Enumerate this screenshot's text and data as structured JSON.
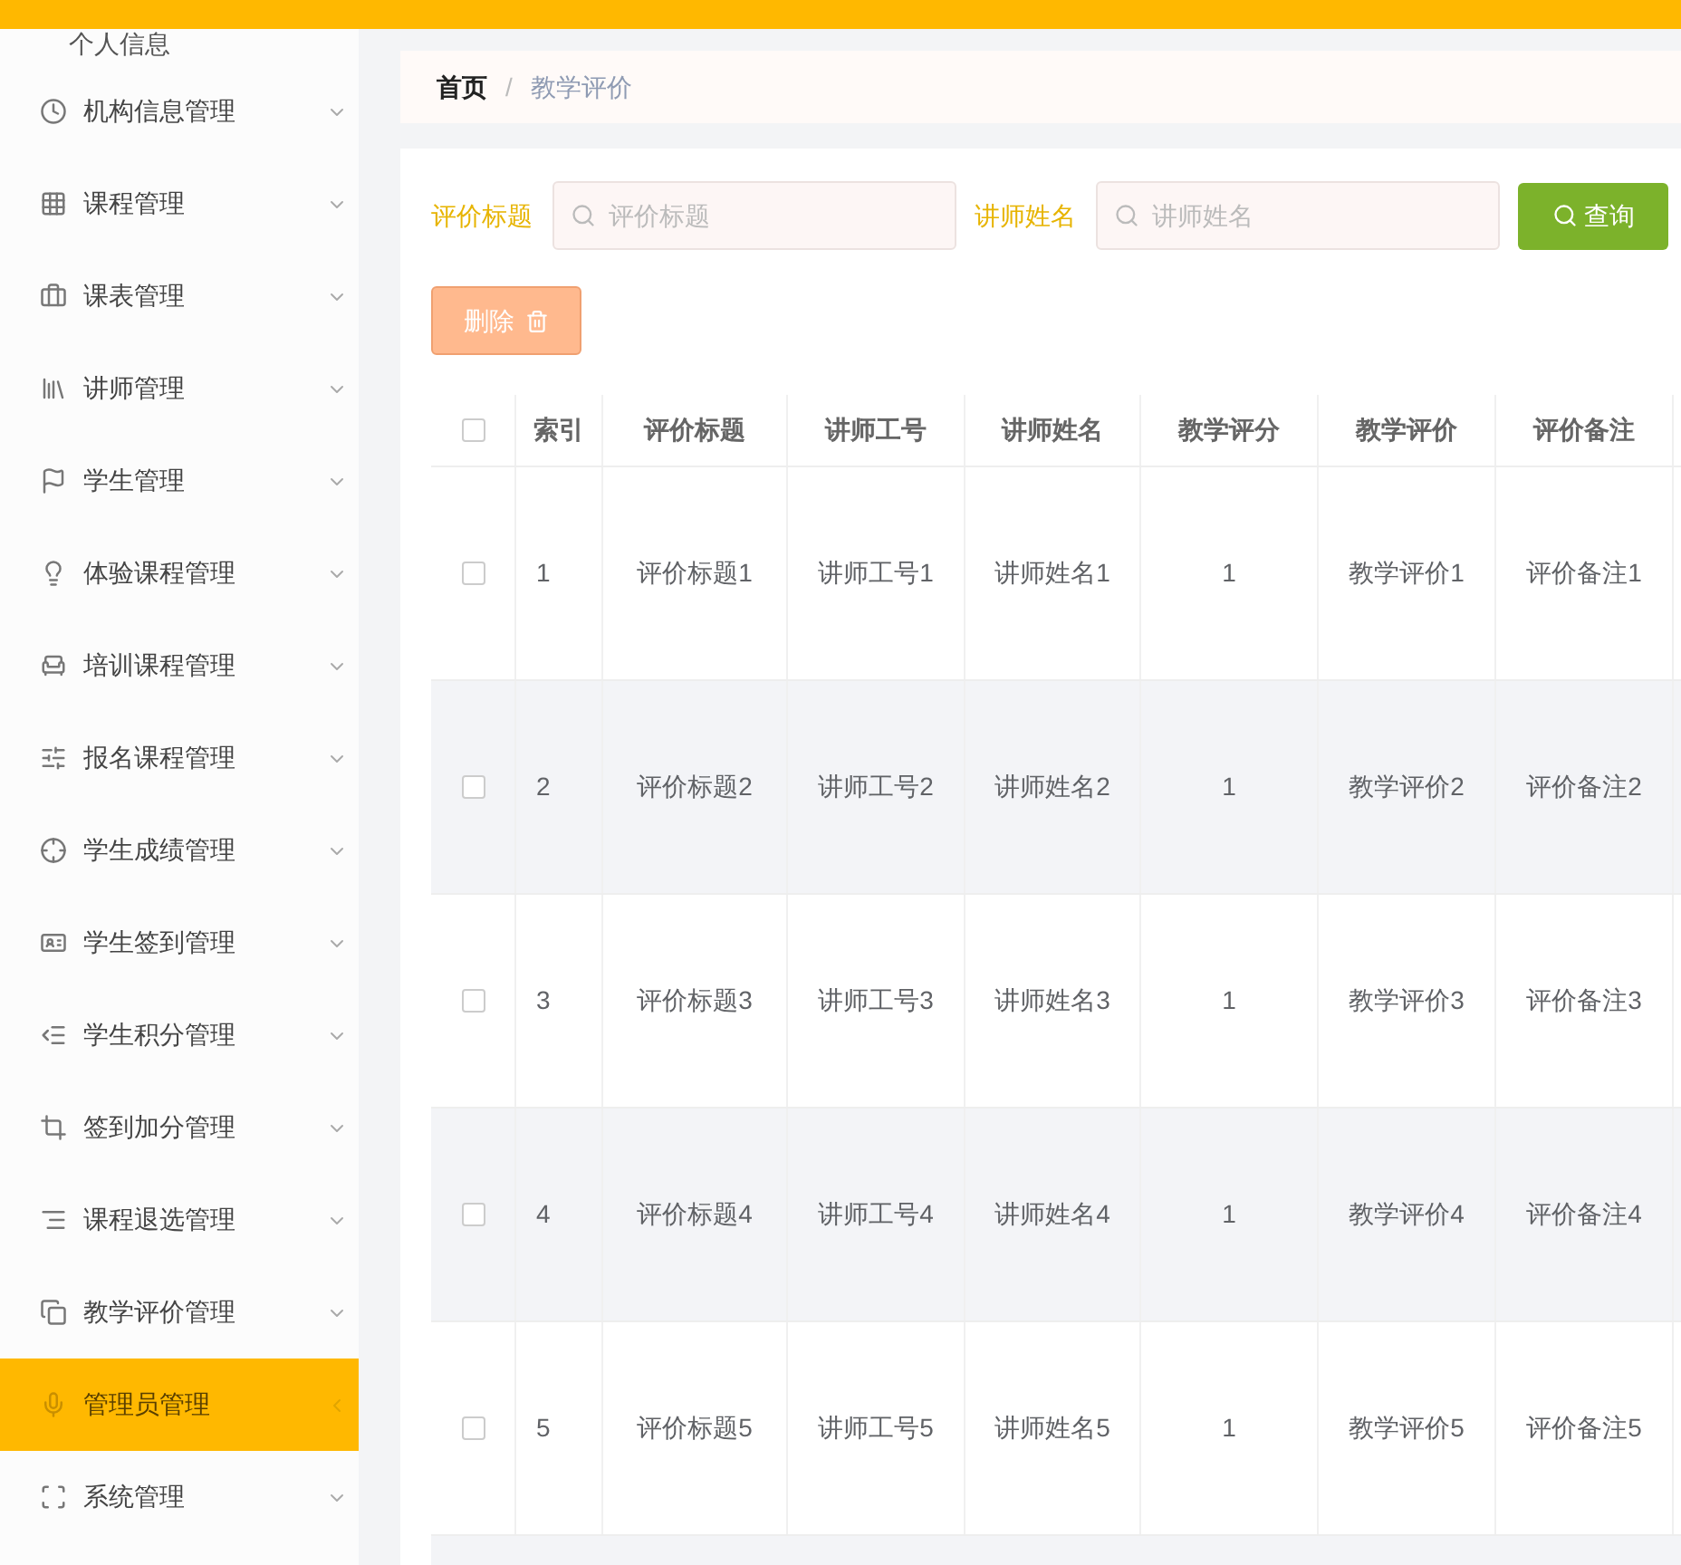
{
  "sidebar": {
    "top_item": "个人信息",
    "items": [
      {
        "label": "机构信息管理",
        "selected": false
      },
      {
        "label": "课程管理",
        "selected": false
      },
      {
        "label": "课表管理",
        "selected": false
      },
      {
        "label": "讲师管理",
        "selected": false
      },
      {
        "label": "学生管理",
        "selected": false
      },
      {
        "label": "体验课程管理",
        "selected": false
      },
      {
        "label": "培训课程管理",
        "selected": false
      },
      {
        "label": "报名课程管理",
        "selected": false
      },
      {
        "label": "学生成绩管理",
        "selected": false
      },
      {
        "label": "学生签到管理",
        "selected": false
      },
      {
        "label": "学生积分管理",
        "selected": false
      },
      {
        "label": "签到加分管理",
        "selected": false
      },
      {
        "label": "课程退选管理",
        "selected": false
      },
      {
        "label": "教学评价管理",
        "selected": false
      },
      {
        "label": "管理员管理",
        "selected": true
      },
      {
        "label": "系统管理",
        "selected": false
      }
    ]
  },
  "breadcrumb": [
    "首页",
    "/",
    "教学评价"
  ],
  "filters": [
    {
      "label": "评价标题",
      "placeholder": "评价标题"
    },
    {
      "label": "讲师姓名",
      "placeholder": "讲师姓名"
    }
  ],
  "search_button": "查询",
  "delete_button": "删除",
  "table": {
    "all_checked": false,
    "columns": [
      "索引",
      "评价标题",
      "讲师工号",
      "讲师姓名",
      "教学评分",
      "教学评价",
      "评价备注"
    ],
    "rows": [
      {
        "checked": false,
        "cells": [
          "1",
          "评价标题1",
          "讲师工号1",
          "讲师姓名1",
          "1",
          "教学评价1",
          "评价备注1"
        ]
      },
      {
        "checked": false,
        "cells": [
          "2",
          "评价标题2",
          "讲师工号2",
          "讲师姓名2",
          "1",
          "教学评价2",
          "评价备注2"
        ]
      },
      {
        "checked": false,
        "cells": [
          "3",
          "评价标题3",
          "讲师工号3",
          "讲师姓名3",
          "1",
          "教学评价3",
          "评价备注3"
        ]
      },
      {
        "checked": false,
        "cells": [
          "4",
          "评价标题4",
          "讲师工号4",
          "讲师姓名4",
          "1",
          "教学评价4",
          "评价备注4"
        ]
      },
      {
        "checked": false,
        "cells": [
          "5",
          "评价标题5",
          "讲师工号5",
          "讲师姓名5",
          "1",
          "教学评价5",
          "评价备注5"
        ]
      }
    ]
  }
}
